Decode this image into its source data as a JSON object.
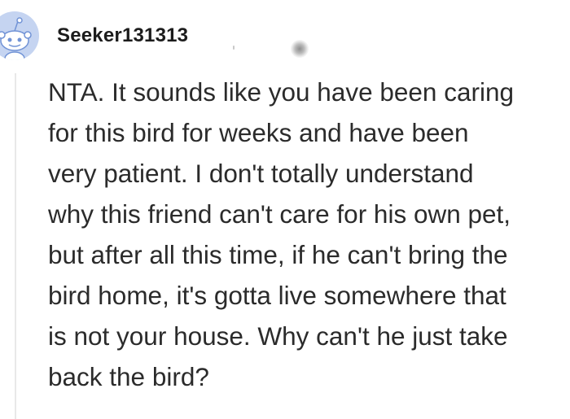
{
  "comment": {
    "author": "Seeker131313",
    "avatar_icon": "reddit-snoo-avatar-icon",
    "avatar_color": "#c5d4f1",
    "body_lines": [
      "NTA. It sounds like you have been caring",
      "for this bird for weeks and have been",
      "very patient. I don't totally understand",
      "why this friend can't care for his own pet,",
      "but after all this time, if he can't bring the",
      "bird home, it's gotta live somewhere that",
      "is not your house. Why can't he just take",
      "back the bird?"
    ]
  }
}
